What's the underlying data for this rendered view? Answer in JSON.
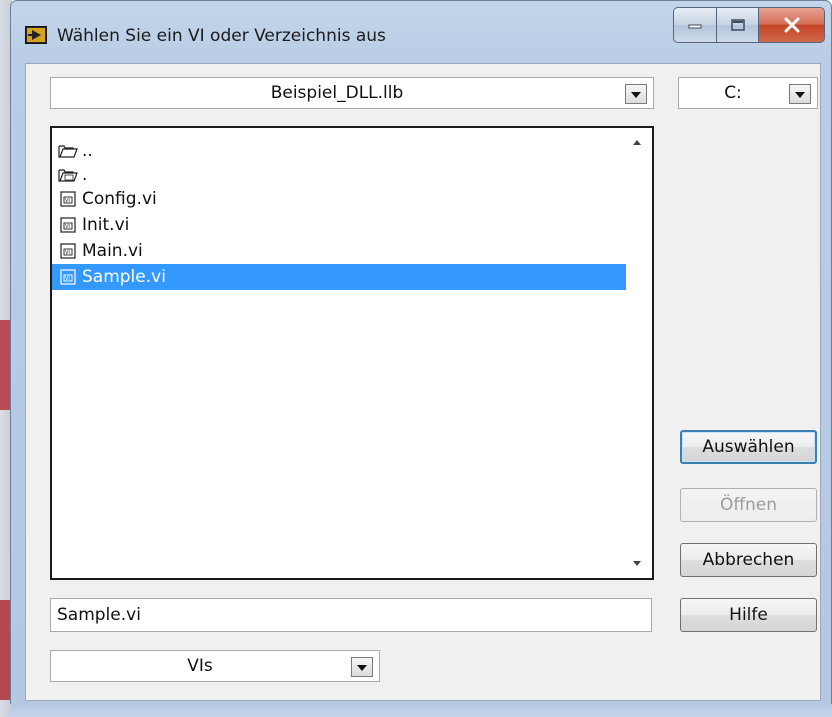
{
  "window": {
    "title": "Wählen Sie ein VI oder Verzeichnis aus"
  },
  "location": {
    "library": "Beispiel_DLL.llb",
    "drive": "C:"
  },
  "files": [
    {
      "name": "..",
      "icon": "folder-open-icon",
      "selected": false
    },
    {
      "name": ".",
      "icon": "folder-vi-icon",
      "selected": false
    },
    {
      "name": "Config.vi",
      "icon": "vi-file-icon",
      "selected": false
    },
    {
      "name": "Init.vi",
      "icon": "vi-file-icon",
      "selected": false
    },
    {
      "name": "Main.vi",
      "icon": "vi-file-icon",
      "selected": false
    },
    {
      "name": "Sample.vi",
      "icon": "vi-file-icon",
      "selected": true
    }
  ],
  "path_value": "Sample.vi",
  "filter": "VIs",
  "buttons": {
    "select": "Auswählen",
    "open": "Öffnen",
    "cancel": "Abbrechen",
    "help": "Hilfe"
  },
  "colors": {
    "selection": "#3399ff",
    "close_button": "#c54325"
  }
}
